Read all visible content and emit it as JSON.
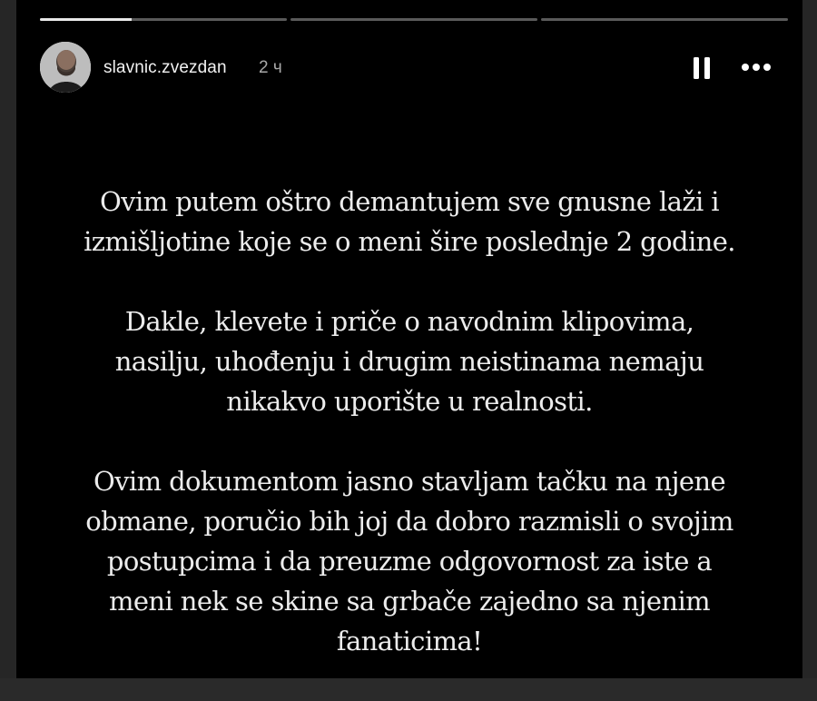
{
  "story": {
    "progress_segments": [
      {
        "fill": 0.37
      },
      {
        "fill": 0
      },
      {
        "fill": 0
      }
    ],
    "user": {
      "username": "slavnic.zvezdan",
      "time_ago": "2 ч",
      "avatar_icon": "profile-avatar"
    },
    "controls": {
      "pause_icon": "pause-icon",
      "more_icon": "more-options-icon"
    },
    "text": {
      "paragraph_1": "Ovim putem oštro demantujem sve gnusne laži i\nizmišljotine koje se o meni šire poslednje 2 godine.",
      "paragraph_2": "Dakle, klevete i priče o navodnim klipovima,\nnasilju, uhođenju i drugim neistinama nemaju\nnikakvo uporište u realnosti.",
      "paragraph_3": "Ovim dokumentom jasno stavljam tačku na njene\nobmane, poručio bih joj da dobro razmisli o svojim\npostupcima i da preuzme odgovornost za iste a\nmeni nek se skine sa grbače zajedno sa njenim\nfanaticima!"
    },
    "colors": {
      "background": "#000000",
      "text": "#ececec",
      "progress_track": "#5a5a5a",
      "progress_fill": "#e8e8e8"
    }
  }
}
